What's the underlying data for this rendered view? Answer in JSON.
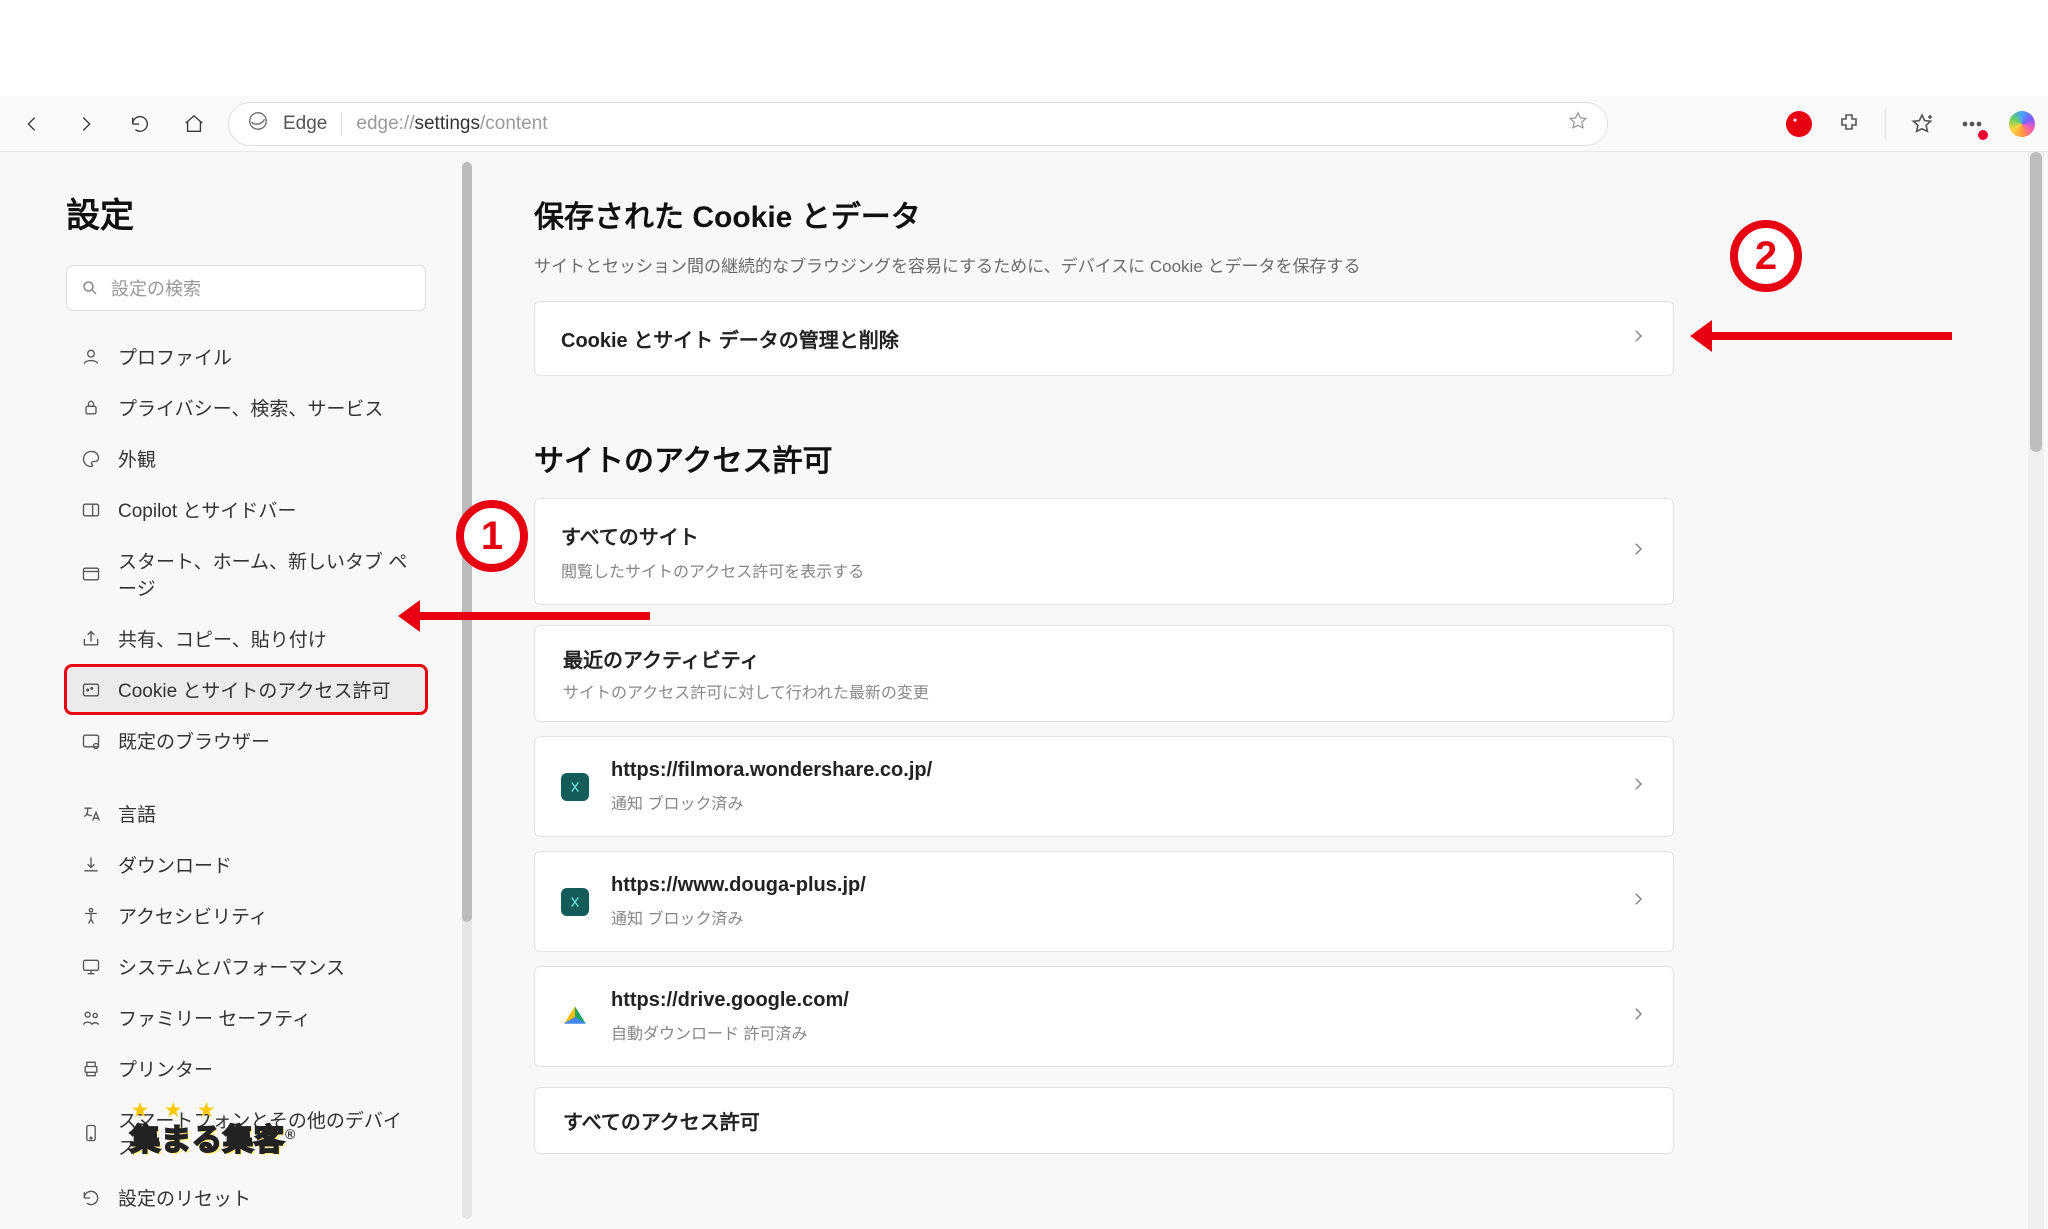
{
  "toolbar": {
    "browser_label": "Edge",
    "url_dim1": "edge://",
    "url_bold": "settings",
    "url_dim2": "/content"
  },
  "sidebar": {
    "title": "設定",
    "search_placeholder": "設定の検索",
    "items": [
      {
        "label": "プロファイル"
      },
      {
        "label": "プライバシー、検索、サービス"
      },
      {
        "label": "外観"
      },
      {
        "label": "Copilot とサイドバー"
      },
      {
        "label": "スタート、ホーム、新しいタブ ページ"
      },
      {
        "label": "共有、コピー、貼り付け"
      },
      {
        "label": "Cookie とサイトのアクセス許可"
      },
      {
        "label": "既定のブラウザー"
      },
      {
        "label": "言語"
      },
      {
        "label": "ダウンロード"
      },
      {
        "label": "アクセシビリティ"
      },
      {
        "label": "システムとパフォーマンス"
      },
      {
        "label": "ファミリー セーフティ"
      },
      {
        "label": "プリンター"
      },
      {
        "label": "スマートフォンとその他のデバイス"
      },
      {
        "label": "設定のリセット"
      }
    ]
  },
  "main": {
    "cookies_title": "保存された Cookie とデータ",
    "cookies_desc": "サイトとセッション間の継続的なブラウジングを容易にするために、デバイスに Cookie とデータを保存する",
    "cookies_manage": "Cookie とサイト データの管理と削除",
    "perm_title": "サイトのアクセス許可",
    "all_sites": "すべてのサイト",
    "all_sites_desc": "閲覧したサイトのアクセス許可を表示する",
    "recent_title": "最近のアクティビティ",
    "recent_desc": "サイトのアクセス許可に対して行われた最新の変更",
    "recent": [
      {
        "url": "https://filmora.wondershare.co.jp/",
        "status": "通知 ブロック済み"
      },
      {
        "url": "https://www.douga-plus.jp/",
        "status": "通知 ブロック済み"
      },
      {
        "url": "https://drive.google.com/",
        "status": "自動ダウンロード 許可済み"
      }
    ],
    "all_perm": "すべてのアクセス許可"
  },
  "annotation": {
    "one": "1",
    "two": "2"
  },
  "watermark": {
    "stars": "★ ★ ★",
    "text": "集まる集客",
    "reg": "®"
  }
}
